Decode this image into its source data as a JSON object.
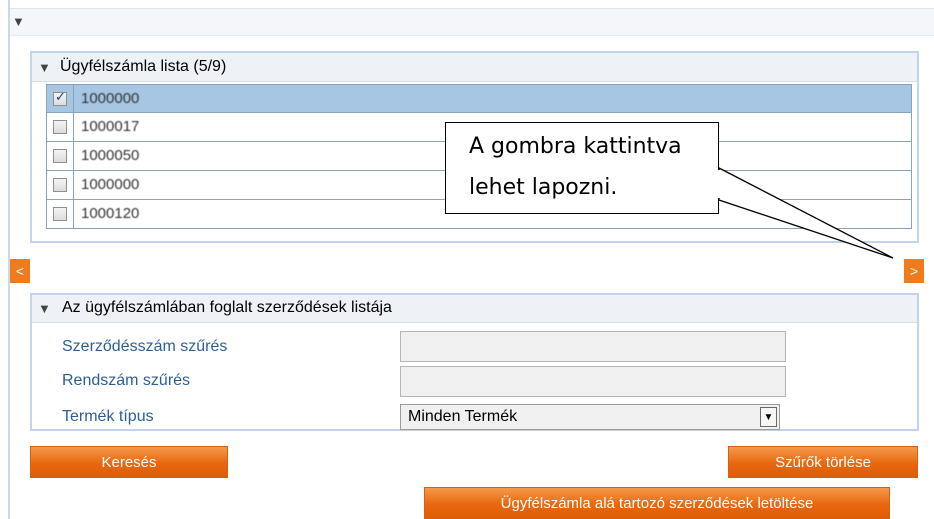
{
  "top_bar": {
    "icon": "triangle-down-icon"
  },
  "account_list": {
    "title": "Ügyfélszámla lista (5/9)",
    "rows": [
      {
        "value": "1000000",
        "checked": true,
        "selected": true
      },
      {
        "value": "1000017",
        "checked": false,
        "selected": false
      },
      {
        "value": "1000050",
        "checked": false,
        "selected": false
      },
      {
        "value": "1000000",
        "checked": false,
        "selected": false
      },
      {
        "value": "1000120",
        "checked": false,
        "selected": false
      }
    ]
  },
  "pager": {
    "prev": "<",
    "next": ">"
  },
  "callout": {
    "line1": "A gombra kattintva",
    "line2": "lehet lapozni."
  },
  "contracts": {
    "title": "Az ügyfélszámlában foglalt szerződések listája",
    "contract_filter_label": "Szerződésszám szűrés",
    "contract_filter_value": "",
    "plate_filter_label": "Rendszám szűrés",
    "plate_filter_value": "",
    "product_type_label": "Termék típus",
    "product_type_value": "Minden Termék"
  },
  "buttons": {
    "search": "Keresés",
    "clear_filters": "Szűrők törlése",
    "download": "Ügyfélszámla alá tartozó szerződések letöltése"
  },
  "colors": {
    "accent": "#f07b1c",
    "selected_row": "#a7c6e3",
    "label_blue": "#2c5f96",
    "panel_border": "#c2d4ea"
  }
}
